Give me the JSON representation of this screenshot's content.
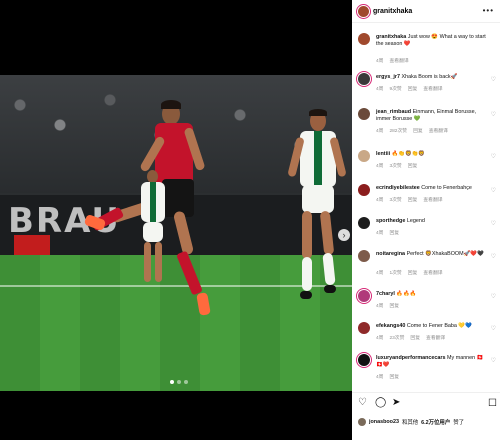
{
  "post": {
    "author": "granitxhaka",
    "caption_author": "granitxhaka",
    "caption_text": "Just wow 😍 What a way to start the season ❤️",
    "caption_time": "4周",
    "caption_translate": "查看翻译",
    "image_text": "BRAU",
    "carousel_dots": 3
  },
  "comments": [
    {
      "user": "ergys_jr7",
      "text": "Xhaka Boom is back🚀",
      "time": "4周",
      "likes": "9次赞",
      "reply": "回复",
      "translate": "查看翻译"
    },
    {
      "user": "jean_rimbaud",
      "text": "Einmann, Einmal Borusse, immer Borusse 💚",
      "time": "4周",
      "likes": "282次赞",
      "reply": "回复",
      "translate": "查看翻译"
    },
    {
      "user": "lentiii",
      "text": "🔥👏🦁👏🦁",
      "time": "4周",
      "likes": "3次赞",
      "reply": "回复",
      "translate": ""
    },
    {
      "user": "ecrindiyebilestee",
      "text": "Come to Fenerbahçe",
      "time": "4周",
      "likes": "3次赞",
      "reply": "回复",
      "translate": "查看翻译"
    },
    {
      "user": "sporthedge",
      "text": "Legend",
      "time": "4周",
      "likes": "",
      "reply": "回复",
      "translate": ""
    },
    {
      "user": "noitaregina",
      "text": "Perfect 🦁XhakaBOOM🚀❤️🖤",
      "time": "4周",
      "likes": "1次赞",
      "reply": "回复",
      "translate": "查看翻译"
    },
    {
      "user": "7charyl",
      "text": "🔥🔥🔥",
      "time": "4周",
      "likes": "",
      "reply": "回复",
      "translate": ""
    },
    {
      "user": "efekangs40",
      "text": "Come to Fener Baba 💛💙",
      "time": "4周",
      "likes": "23次赞",
      "reply": "回复",
      "translate": "查看翻译"
    },
    {
      "user": "luxuryandperformancecars",
      "text": "My mannen 🇨🇭🇨🇭❤️",
      "time": "4周",
      "likes": "",
      "reply": "回复",
      "translate": ""
    }
  ],
  "footer": {
    "likes_user": "jonasboo23",
    "likes_text": "和其他",
    "likes_count": "6.2万位用户",
    "likes_suffix": "赞了"
  },
  "icons": {
    "heart": "heart-icon",
    "comment": "comment-icon",
    "share": "share-icon",
    "bookmark": "bookmark-icon",
    "more": "more-icon",
    "next": "chevron-right-icon"
  },
  "colors": {
    "leverkusen_red": "#c3132b",
    "pitch_green": "#3e8f36",
    "story_ring": "#d62976"
  }
}
